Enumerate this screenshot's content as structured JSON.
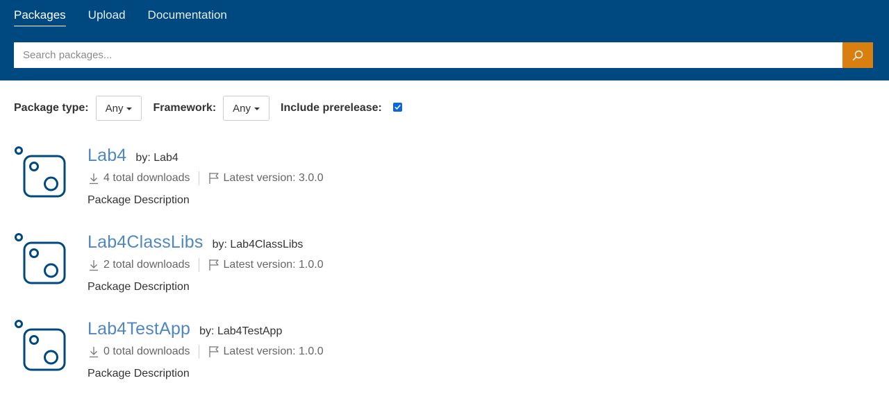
{
  "nav": {
    "items": [
      {
        "label": "Packages",
        "active": true
      },
      {
        "label": "Upload",
        "active": false
      },
      {
        "label": "Documentation",
        "active": false
      }
    ]
  },
  "search": {
    "placeholder": "Search packages...",
    "value": "",
    "button_icon": "search-icon"
  },
  "filters": {
    "package_type_label": "Package type:",
    "package_type_value": "Any",
    "framework_label": "Framework:",
    "framework_value": "Any",
    "prerelease_label": "Include prerelease:",
    "prerelease_checked": true
  },
  "packages": [
    {
      "name": "Lab4",
      "author": "by: Lab4",
      "downloads": "4 total downloads",
      "latest_version": "Latest version: 3.0.0",
      "description": "Package Description"
    },
    {
      "name": "Lab4ClassLibs",
      "author": "by: Lab4ClassLibs",
      "downloads": "2 total downloads",
      "latest_version": "Latest version: 1.0.0",
      "description": "Package Description"
    },
    {
      "name": "Lab4TestApp",
      "author": "by: Lab4TestApp",
      "downloads": "0 total downloads",
      "latest_version": "Latest version: 1.0.0",
      "description": "Package Description"
    }
  ],
  "colors": {
    "header_bg": "#004880",
    "search_button": "#d87f10",
    "link": "#4f87c2",
    "icon_stroke": "#004880",
    "checkbox": "#0b66d6"
  }
}
